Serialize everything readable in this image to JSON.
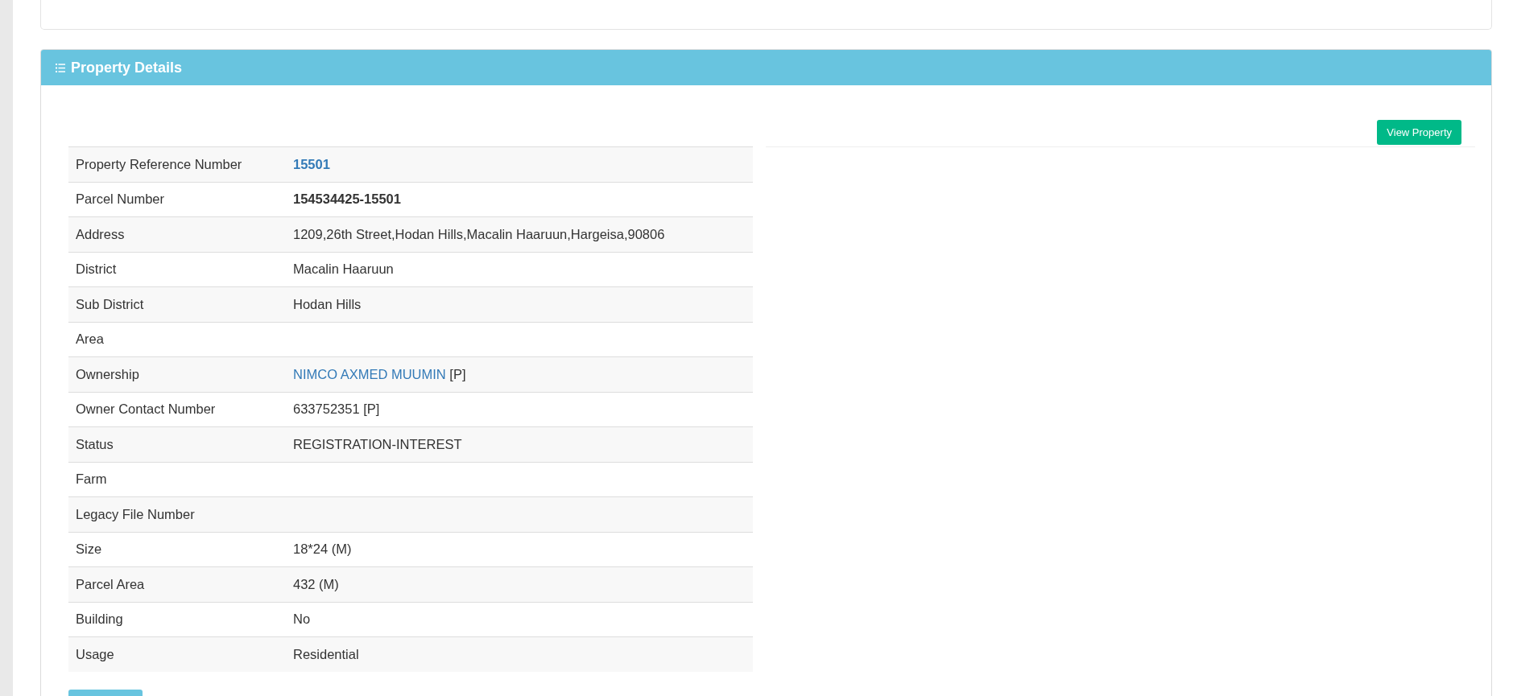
{
  "panel": {
    "title": "Property Details",
    "action_button": "View Property"
  },
  "details": [
    {
      "label": "Property Reference Number",
      "value": "15501",
      "kind": "link-bold"
    },
    {
      "label": "Parcel Number",
      "value": "154534425-15501",
      "kind": "bold"
    },
    {
      "label": "Address",
      "value": "1209,26th Street,Hodan Hills,Macalin Haaruun,Hargeisa,90806",
      "kind": "text"
    },
    {
      "label": "District",
      "value": "Macalin Haaruun",
      "kind": "text"
    },
    {
      "label": "Sub District",
      "value": "Hodan Hills",
      "kind": "text"
    },
    {
      "label": "Area",
      "kind": "text"
    },
    {
      "label": "Ownership",
      "value": "NIMCO AXMED MUUMIN",
      "suffix": "[P]",
      "kind": "link"
    },
    {
      "label": "Owner Contact Number",
      "value": "633752351 [P]",
      "kind": "text"
    },
    {
      "label": "Status",
      "value": "REGISTRATION-INTEREST",
      "kind": "text"
    },
    {
      "label": "Farm",
      "kind": "text"
    },
    {
      "label": "Legacy File Number",
      "kind": "text"
    },
    {
      "label": "Size",
      "value": "18*24 (M)",
      "kind": "text"
    },
    {
      "label": "Parcel Area",
      "value": "432 (M)",
      "kind": "text"
    },
    {
      "label": "Building",
      "value": "No",
      "kind": "text"
    },
    {
      "label": "Usage",
      "value": "Residential",
      "kind": "text"
    }
  ]
}
